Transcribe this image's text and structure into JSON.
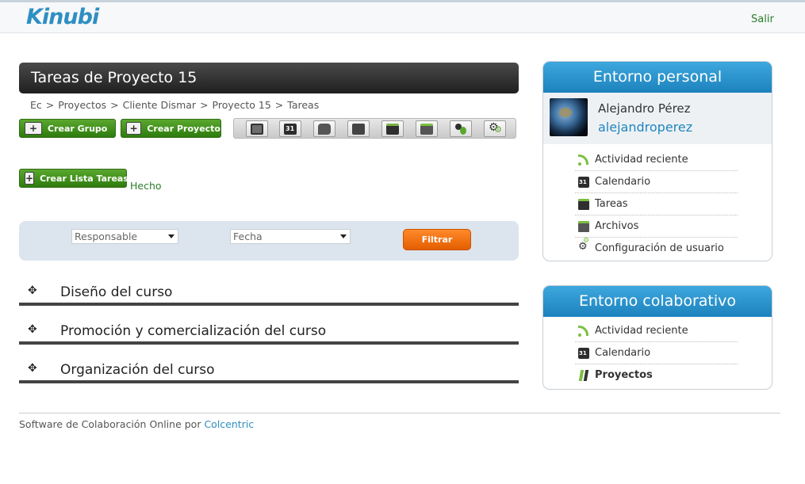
{
  "header": {
    "logo_text": "Kinubi",
    "logout_label": "Salir"
  },
  "page": {
    "title": "Tareas de Proyecto 15"
  },
  "breadcrumb": [
    "Ec",
    "Proyectos",
    "Cliente Dismar",
    "Proyecto 15",
    "Tareas"
  ],
  "breadcrumb_separator": ">",
  "actions": {
    "create_group": "Crear  Grupo",
    "create_project": "Crear  Proyecto",
    "create_task_list": "Crear  Lista Tareas",
    "done_link": "Hecho"
  },
  "toolbar_icons": [
    "overview-icon",
    "calendar-icon",
    "messages-icon",
    "notes-icon",
    "tasks-icon",
    "files-icon",
    "people-icon",
    "settings-icon"
  ],
  "filter": {
    "responsible_value": "Responsable",
    "date_value": "Fecha",
    "button_label": "Filtrar"
  },
  "task_lists": [
    {
      "name": "Diseño del curso"
    },
    {
      "name": "Promoción y comercialización del curso"
    },
    {
      "name": "Organización del curso"
    }
  ],
  "footer": {
    "text": "Software de Colaboración Online por ",
    "link": "Colcentric"
  },
  "personal": {
    "title": "Entorno personal",
    "user_name": "Alejandro Pérez",
    "username": "alejandroperez",
    "items": [
      {
        "label": "Actividad reciente",
        "icon": "rss-icon"
      },
      {
        "label": "Calendario",
        "icon": "calendar-icon"
      },
      {
        "label": "Tareas",
        "icon": "tasks-icon"
      },
      {
        "label": "Archivos",
        "icon": "files-icon"
      },
      {
        "label": "Configuración de usuario",
        "icon": "gear-icon"
      }
    ]
  },
  "collab": {
    "title": "Entorno colaborativo",
    "items": [
      {
        "label": "Actividad reciente",
        "icon": "rss-icon"
      },
      {
        "label": "Calendario",
        "icon": "calendar-icon"
      },
      {
        "label": "Proyectos",
        "icon": "projects-icon",
        "active": true
      }
    ]
  },
  "colors": {
    "brand_blue": "#2e8fc4",
    "action_green": "#2d7c0e",
    "filter_orange": "#e35e00",
    "link_green": "#2a7d2a"
  }
}
